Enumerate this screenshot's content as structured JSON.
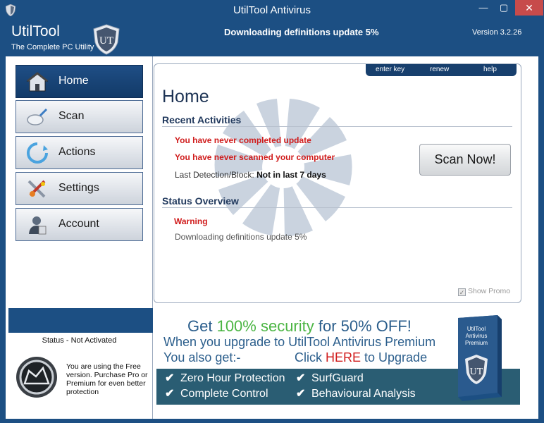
{
  "window": {
    "title": "UtilTool Antivirus",
    "minimize": "—",
    "maximize": "▢",
    "close": "✕"
  },
  "header": {
    "brand": "UtilTool",
    "tagline": "The Complete PC Utility",
    "download_status": "Downloading definitions update 5%",
    "version": "Version 3.2.26"
  },
  "sidebar": {
    "items": [
      {
        "label": "Home",
        "icon": "house-icon",
        "active": true
      },
      {
        "label": "Scan",
        "icon": "magnifier-icon",
        "active": false
      },
      {
        "label": "Actions",
        "icon": "refresh-icon",
        "active": false
      },
      {
        "label": "Settings",
        "icon": "tools-icon",
        "active": false
      },
      {
        "label": "Account",
        "icon": "user-icon",
        "active": false
      }
    ],
    "status_title": "Status - Not Activated",
    "status_message": "You are using the Free version. Purchase Pro or Premium for even better protection"
  },
  "top_tabs": [
    "enter key",
    "renew",
    "help"
  ],
  "main": {
    "title": "Home",
    "recent_title": "Recent Activities",
    "activities": [
      "You have never completed update",
      "You have never scanned your computer"
    ],
    "last_detection_label": "Last Detection/Block:",
    "last_detection_value": "Not in last 7 days",
    "scan_button": "Scan Now!",
    "status_title": "Status Overview",
    "status_warning": "Warning",
    "status_detail": "Downloading definitions update 5%",
    "show_promo": "Show Promo",
    "show_promo_checked": true
  },
  "promo": {
    "line1_a": "Get ",
    "line1_b": "100% security",
    "line1_c": " for 50% OFF!",
    "line2": "When you upgrade to UtilTool Antivirus Premium",
    "line3": "You also get:-",
    "cta_a": "Click ",
    "cta_b": "HERE",
    "cta_c": " to Upgrade",
    "features": [
      "Zero Hour Protection",
      "Complete Control",
      "SurfGuard",
      "Behavioural Analysis"
    ],
    "box_text": "UtilTool Antivirus Premium"
  },
  "colors": {
    "brand_blue": "#1c4f83",
    "warning_red": "#d01c1c",
    "promo_green": "#4bb543",
    "promo_bar": "#2a5d73"
  }
}
